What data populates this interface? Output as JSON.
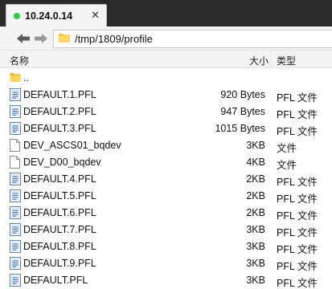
{
  "tab": {
    "title": "10.24.0.14",
    "close": "✕",
    "status_color": "#2ecc40"
  },
  "navbar": {
    "path": "/tmp/1809/profile"
  },
  "columns": {
    "name": "名称",
    "size": "大小",
    "type": "类型"
  },
  "files": [
    {
      "name": "..",
      "size": "",
      "type": "",
      "icon": "folder-icon"
    },
    {
      "name": "DEFAULT.1.PFL",
      "size": "920 Bytes",
      "type": "PFL 文件",
      "icon": "pfl-file-icon"
    },
    {
      "name": "DEFAULT.2.PFL",
      "size": "947 Bytes",
      "type": "PFL 文件",
      "icon": "pfl-file-icon"
    },
    {
      "name": "DEFAULT.3.PFL",
      "size": "1015 Bytes",
      "type": "PFL 文件",
      "icon": "pfl-file-icon"
    },
    {
      "name": "DEV_ASCS01_bqdev",
      "size": "3KB",
      "type": "文件",
      "icon": "blank-file-icon"
    },
    {
      "name": "DEV_D00_bqdev",
      "size": "4KB",
      "type": "文件",
      "icon": "blank-file-icon"
    },
    {
      "name": "DEFAULT.4.PFL",
      "size": "2KB",
      "type": "PFL 文件",
      "icon": "pfl-file-icon"
    },
    {
      "name": "DEFAULT.5.PFL",
      "size": "2KB",
      "type": "PFL 文件",
      "icon": "pfl-file-icon"
    },
    {
      "name": "DEFAULT.6.PFL",
      "size": "2KB",
      "type": "PFL 文件",
      "icon": "pfl-file-icon"
    },
    {
      "name": "DEFAULT.7.PFL",
      "size": "3KB",
      "type": "PFL 文件",
      "icon": "pfl-file-icon"
    },
    {
      "name": "DEFAULT.8.PFL",
      "size": "3KB",
      "type": "PFL 文件",
      "icon": "pfl-file-icon"
    },
    {
      "name": "DEFAULT.9.PFL",
      "size": "3KB",
      "type": "PFL 文件",
      "icon": "pfl-file-icon"
    },
    {
      "name": "DEFAULT.PFL",
      "size": "3KB",
      "type": "PFL 文件",
      "icon": "pfl-file-icon"
    }
  ]
}
